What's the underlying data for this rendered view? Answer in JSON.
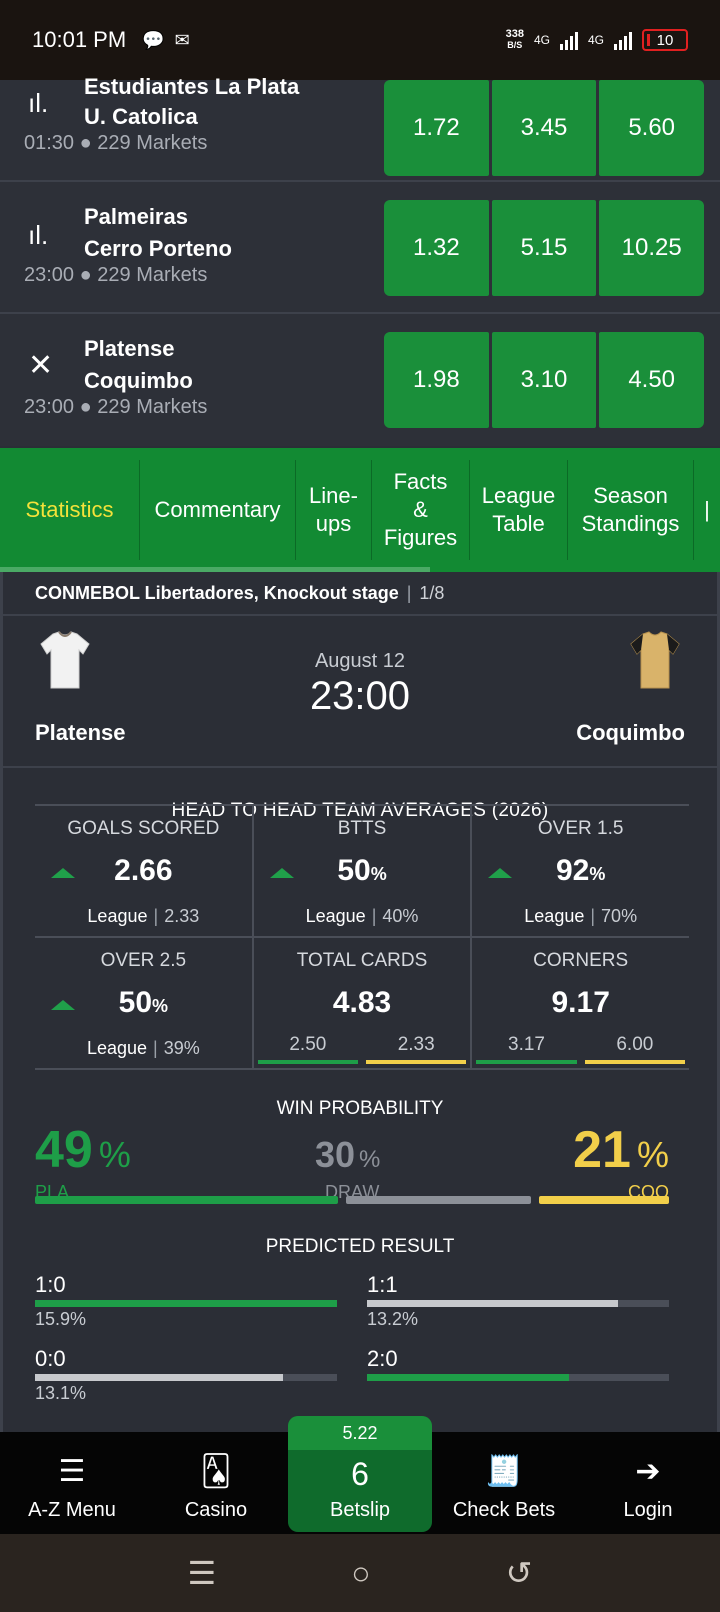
{
  "status_bar": {
    "time": "10:01 PM",
    "net_speed": "338",
    "net_unit": "B/S",
    "net1": "4G",
    "net2": "4G",
    "battery": "10"
  },
  "matches": [
    {
      "home": "Estudiantes La Plata",
      "away": "U. Catolica",
      "time": "01:30",
      "markets": "229 Markets",
      "odds": [
        "1.72",
        "3.45",
        "5.60"
      ],
      "icon": "live-stats-icon"
    },
    {
      "home": "Palmeiras",
      "away": "Cerro Porteno",
      "time": "23:00",
      "markets": "229 Markets",
      "odds": [
        "1.32",
        "5.15",
        "10.25"
      ],
      "icon": "live-stats-icon"
    },
    {
      "home": "Platense",
      "away": "Coquimbo",
      "time": "23:00",
      "markets": "229 Markets",
      "odds": [
        "1.98",
        "3.10",
        "4.50"
      ],
      "icon": "close-icon"
    }
  ],
  "tabs": [
    "Statistics",
    "Commentary",
    "Line-\nups",
    "Facts\n&\nFigures",
    "League\nTable",
    "Season\nStandings"
  ],
  "competition": {
    "name": "CONMEBOL Libertadores, Knockout stage",
    "stage": "1/8"
  },
  "fixture": {
    "date": "August 12",
    "time": "23:00",
    "home": "Platense",
    "away": "Coquimbo"
  },
  "h2h": {
    "title": "HEAD TO HEAD TEAM AVERAGES (2026)",
    "league_label": "League",
    "goals": {
      "label": "GOALS SCORED",
      "value": "2.66",
      "league": "2.33"
    },
    "btts": {
      "label": "BTTS",
      "value": "50",
      "unit": "%",
      "league": "40%"
    },
    "over15": {
      "label": "OVER 1.5",
      "value": "92",
      "unit": "%",
      "league": "70%"
    },
    "over25": {
      "label": "OVER 2.5",
      "value": "50",
      "unit": "%",
      "league": "39%"
    },
    "cards": {
      "label": "TOTAL CARDS",
      "value": "4.83",
      "home": "2.50",
      "away": "2.33"
    },
    "corners": {
      "label": "CORNERS",
      "value": "9.17",
      "home": "3.17",
      "away": "6.00"
    }
  },
  "win_probability": {
    "title": "WIN PROBABILITY",
    "home_pct": "49",
    "home_label": "PLA",
    "draw_pct": "30",
    "draw_label": "DRAW",
    "away_pct": "21",
    "away_label": "COQ",
    "pct_sign": "%"
  },
  "predicted": {
    "title": "PREDICTED RESULT",
    "items": [
      {
        "score": "1:0",
        "pct": "15.9%",
        "fill": 1.0,
        "color": "#1e9e48"
      },
      {
        "score": "1:1",
        "pct": "13.2%",
        "fill": 0.83,
        "color": "#c7c9cd"
      },
      {
        "score": "0:0",
        "pct": "13.1%",
        "fill": 0.82,
        "color": "#c7c9cd"
      },
      {
        "score": "2:0",
        "pct": "",
        "fill": 0.67,
        "color": "#1e9e48"
      }
    ]
  },
  "bottom_nav": {
    "az": "A-Z Menu",
    "casino": "Casino",
    "betslip_odds": "5.22",
    "betslip_count": "6",
    "betslip": "Betslip",
    "check": "Check Bets",
    "login": "Login"
  },
  "colors": {
    "green": "#1a8f3a",
    "home": "#1e9e48",
    "away": "#f2cf4a",
    "draw": "#8c9098"
  }
}
